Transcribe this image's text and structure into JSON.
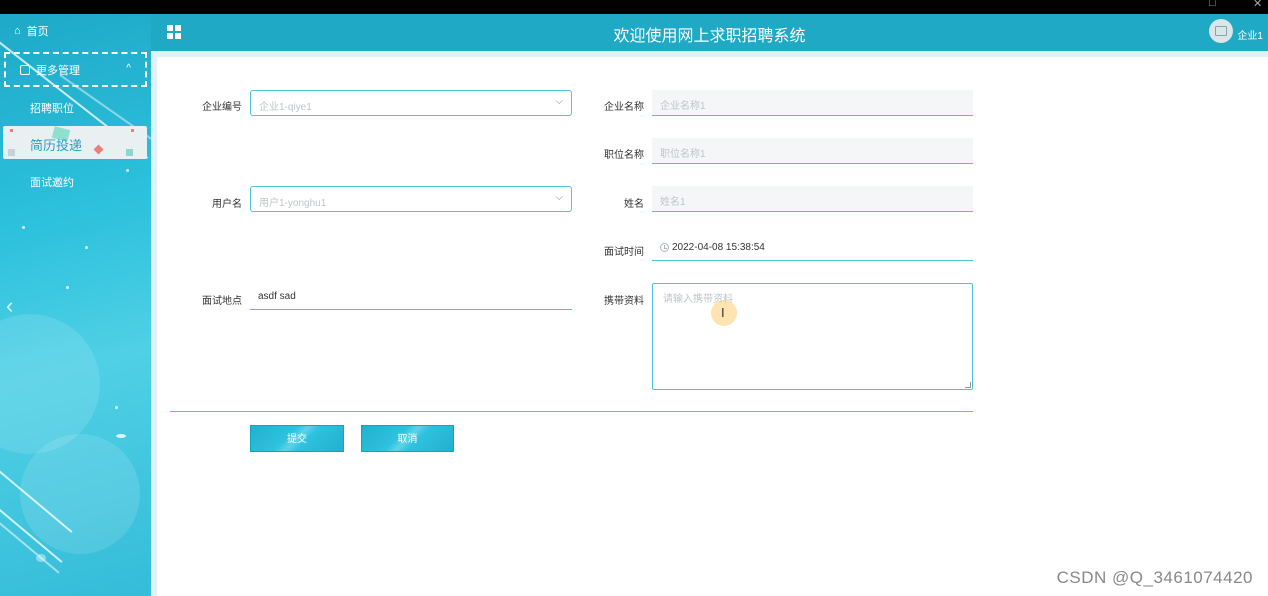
{
  "colors": {
    "accent": "#1fa9c5",
    "border": "#4ec2d9",
    "placeholder": "#c0c4cc"
  },
  "header": {
    "title": "欢迎使用网上求职招聘系统",
    "user": "企业1",
    "menu_icon": "grid-icon",
    "avatar_icon": "image-icon"
  },
  "sidebar": {
    "home": {
      "label": "首页",
      "icon": "home-icon"
    },
    "group": {
      "label": "更多管理",
      "icon": "copy-icon",
      "chevron": "^"
    },
    "items": [
      {
        "label": "招聘职位"
      },
      {
        "label": "简历投递"
      },
      {
        "label": "面试邀约"
      }
    ],
    "collapse": "‹"
  },
  "form": {
    "company_id": {
      "label": "企业编号",
      "placeholder": "企业1-qiye1"
    },
    "company_name": {
      "label": "企业名称",
      "placeholder": "企业名称1"
    },
    "position_name": {
      "label": "职位名称",
      "placeholder": "职位名称1"
    },
    "username": {
      "label": "用户名",
      "placeholder": "用户1-yonghu1"
    },
    "name": {
      "label": "姓名",
      "placeholder": "姓名1"
    },
    "interview_time": {
      "label": "面试时间",
      "value": "2022-04-08 15:38:54"
    },
    "interview_location": {
      "label": "面试地点",
      "value": "asdf sad"
    },
    "materials": {
      "label": "携带资料",
      "placeholder": "请输入携带资料"
    },
    "submit": "提交",
    "cancel": "取消"
  },
  "watermark": "CSDN @Q_3461074420",
  "window_controls": [
    "□",
    "✕"
  ]
}
